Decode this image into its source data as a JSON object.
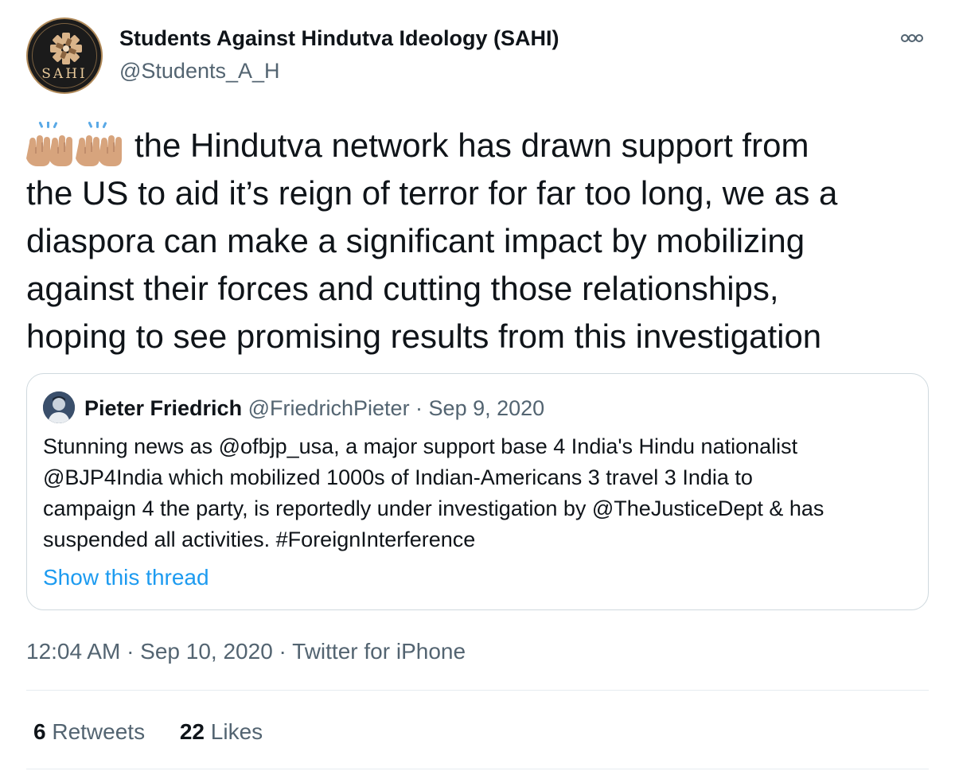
{
  "author": {
    "name": "Students Against Hindutva Ideology (SAHI)",
    "handle": "@Students_A_H",
    "avatar_text": "SAHI"
  },
  "more_icon": "more-options-icon",
  "tweet": {
    "emoji": "raising-hands-emoji",
    "lines": [
      "the Hindutva network has drawn support from",
      "the US to aid it’s reign of terror for far too long, we as a",
      "diaspora can make a significant impact by mobilizing",
      "against their forces and cutting those relationships,",
      "hoping to see promising results from this investigation"
    ]
  },
  "quote": {
    "name": "Pieter Friedrich",
    "meta": "@FriedrichPieter · Sep 9, 2020",
    "lines": [
      "Stunning news as @ofbjp_usa, a major support base 4 India's Hindu nationalist",
      "@BJP4India which mobilized 1000s of Indian-Americans 3 travel 3 India to",
      "campaign 4 the party, is reportedly under investigation by @TheJusticeDept & has",
      "suspended all activities. #ForeignInterference"
    ],
    "show_thread": "Show this thread"
  },
  "timestamp": "12:04 AM · Sep 10, 2020 · Twitter for iPhone",
  "stats": {
    "retweets_count": "6",
    "retweets_label": "Retweets",
    "likes_count": "22",
    "likes_label": "Likes"
  },
  "colors": {
    "link": "#1d9bf0",
    "secondary_text": "#536471",
    "border": "#cfd9de",
    "logo_gold": "#e8c99a"
  }
}
